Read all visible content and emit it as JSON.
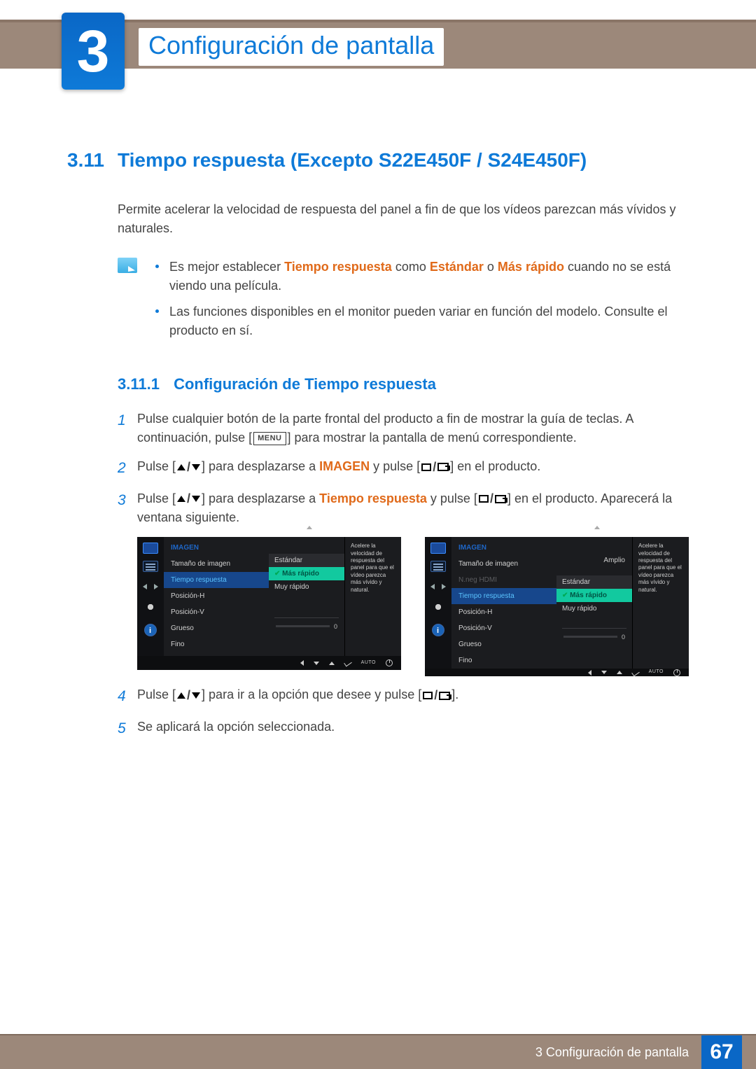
{
  "chapter": {
    "number": "3",
    "title": "Configuración de pantalla"
  },
  "section": {
    "number": "3.11",
    "title": "Tiempo respuesta (Excepto S22E450F / S24E450F)"
  },
  "intro": "Permite acelerar la velocidad de respuesta del panel a fin de que los vídeos parezcan más vívidos y naturales.",
  "notes": {
    "n1_pre": "Es mejor establecer ",
    "n1_term1": "Tiempo respuesta",
    "n1_mid1": " como ",
    "n1_term2": "Estándar",
    "n1_mid2": " o ",
    "n1_term3": "Más rápido",
    "n1_post": " cuando no se está viendo una película.",
    "n2": "Las funciones disponibles en el monitor pueden variar en función del modelo. Consulte el producto en sí."
  },
  "subsection": {
    "number": "3.11.1",
    "title": "Configuración de Tiempo respuesta"
  },
  "steps": {
    "s1_a": "Pulse cualquier botón de la parte frontal del producto a fin de mostrar la guía de teclas. A continuación, pulse [",
    "s1_menu": "MENU",
    "s1_b": "] para mostrar la pantalla de menú correspondiente.",
    "s2_a": "Pulse [",
    "s2_b": "] para desplazarse a ",
    "s2_term": "IMAGEN",
    "s2_c": " y pulse [",
    "s2_d": "] en el producto.",
    "s3_a": "Pulse [",
    "s3_b": "] para desplazarse a ",
    "s3_term": "Tiempo respuesta",
    "s3_c": " y pulse [",
    "s3_d": "] en el producto. Aparecerá la ventana siguiente.",
    "s4_a": "Pulse [",
    "s4_b": "] para ir a la opción que desee y pulse [",
    "s4_c": "].",
    "s5": "Se aplicará la opción seleccionada.",
    "numbers": {
      "n1": "1",
      "n2": "2",
      "n3": "3",
      "n4": "4",
      "n5": "5"
    }
  },
  "osd": {
    "desc": "Acelere la velocidad de respuesta del panel para que el vídeo parezca más vívido y natural.",
    "title": "IMAGEN",
    "items": {
      "size": "Tamaño de imagen",
      "hdmi": "N.neg HDMI",
      "resp": "Tiempo respuesta",
      "posh": "Posición-H",
      "posv": "Posición-V",
      "coarse": "Grueso",
      "fine": "Fino"
    },
    "values": {
      "std": "Estándar",
      "faster": "Más rápido",
      "muy": "Muy rápido",
      "wide": "Amplio",
      "zero": "0"
    },
    "nav_auto": "AUTO"
  },
  "footer": {
    "text": "3 Configuración de pantalla",
    "page": "67"
  }
}
